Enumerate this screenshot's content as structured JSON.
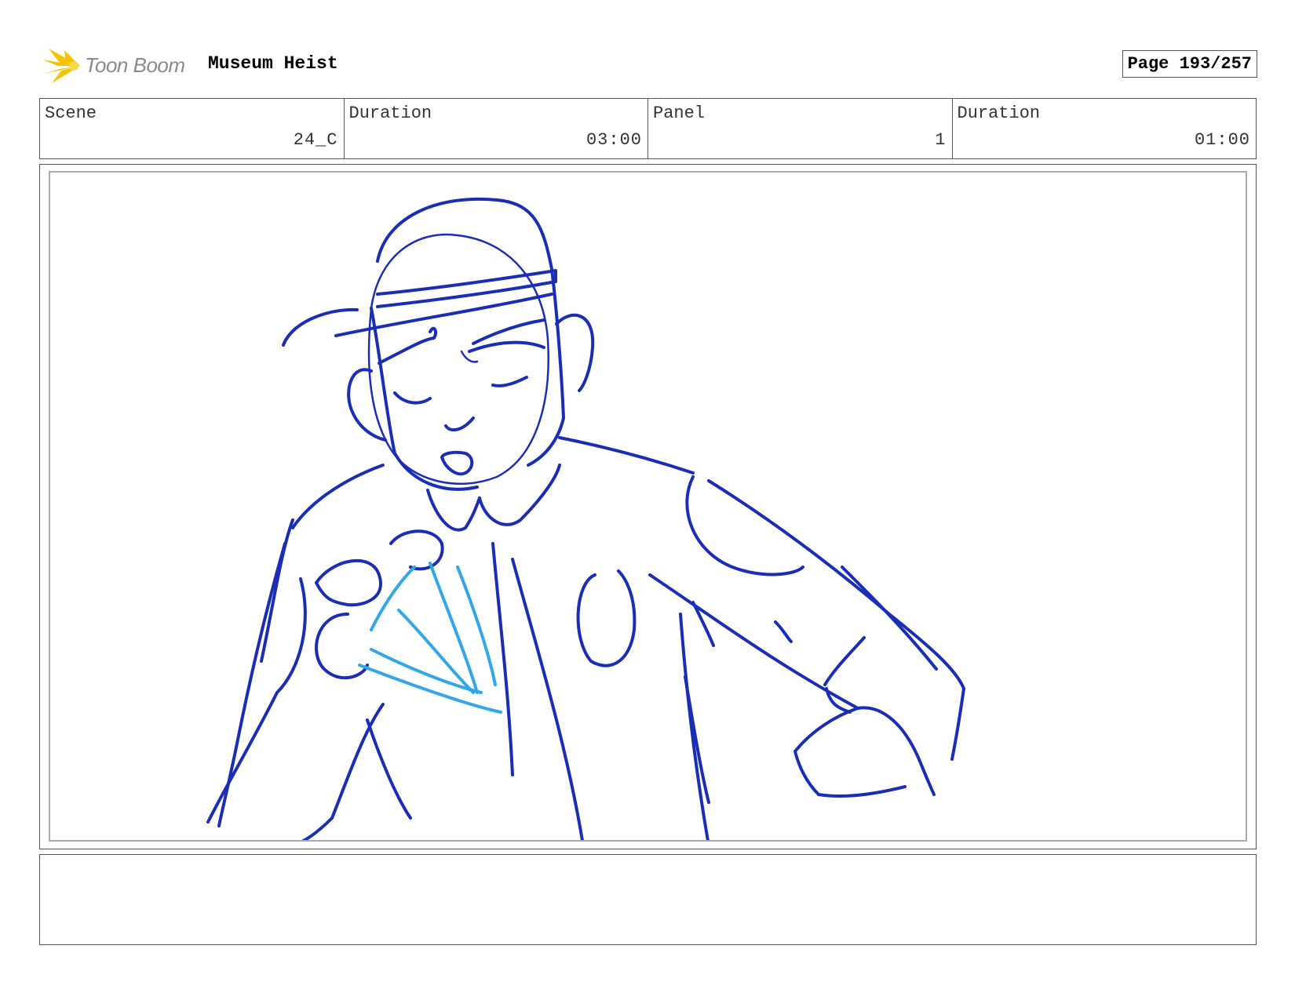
{
  "header": {
    "logo_text": "Toon Boom",
    "project_title": "Museum Heist",
    "page_label": "Page 193/257"
  },
  "info": [
    {
      "label": "Scene",
      "value": "24_C"
    },
    {
      "label": "Duration",
      "value": "03:00"
    },
    {
      "label": "Panel",
      "value": "1"
    },
    {
      "label": "Duration",
      "value": "01:00"
    }
  ],
  "notes": {
    "text": ""
  },
  "colors": {
    "sketch_dark": "#1a2eb5",
    "sketch_light": "#33a6e8",
    "logo_yellow": "#f5c400"
  }
}
